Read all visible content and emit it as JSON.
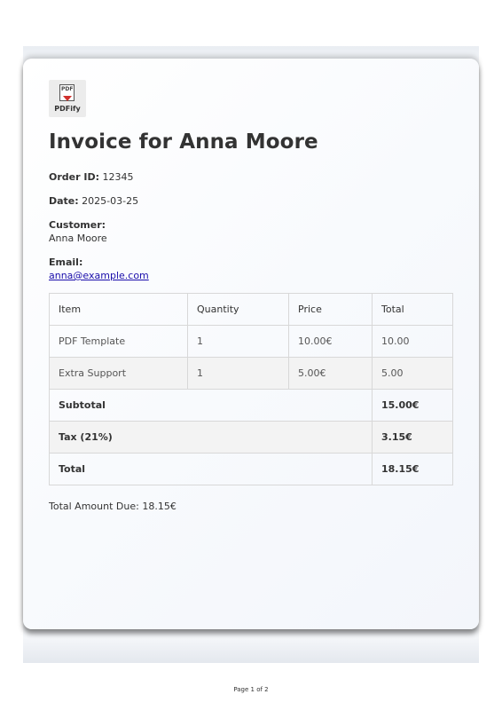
{
  "logo": {
    "doc_label": "PDF",
    "name": "PDFify"
  },
  "invoice": {
    "title": "Invoice for Anna Moore",
    "order_id_label": "Order ID:",
    "order_id": "12345",
    "date_label": "Date:",
    "date": "2025-03-25",
    "customer_label": "Customer:",
    "customer": "Anna Moore",
    "email_label": "Email:",
    "email": "anna@example.com"
  },
  "table": {
    "headers": [
      "Item",
      "Quantity",
      "Price",
      "Total"
    ],
    "rows": [
      {
        "item": "PDF Template",
        "quantity": "1",
        "price": "10.00€",
        "total": "10.00"
      },
      {
        "item": "Extra Support",
        "quantity": "1",
        "price": "5.00€",
        "total": "5.00"
      }
    ],
    "subtotal_label": "Subtotal",
    "subtotal": "15.00€",
    "tax_label": "Tax (21%)",
    "tax": "3.15€",
    "total_label": "Total",
    "total": "18.15€"
  },
  "amount_due": "Total Amount Due: 18.15€",
  "page_number": "Page 1 of 2"
}
